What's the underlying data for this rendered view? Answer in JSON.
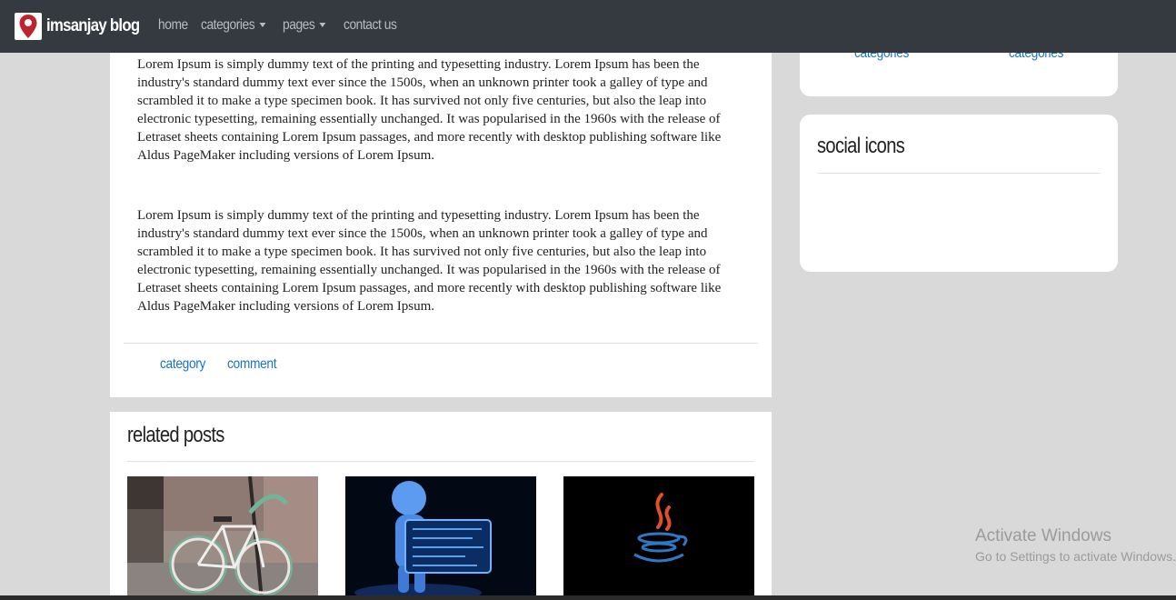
{
  "navbar": {
    "brand": "imsanjay blog",
    "items": [
      {
        "label": "home",
        "dropdown": false
      },
      {
        "label": "categories",
        "dropdown": true
      },
      {
        "label": "pages",
        "dropdown": true
      },
      {
        "label": "contact us",
        "dropdown": false
      }
    ]
  },
  "article": {
    "paragraphs": [
      "Lorem Ipsum is simply dummy text of the printing and typesetting industry. Lorem Ipsum has been the industry's standard dummy text ever since the 1500s, when an unknown printer took a galley of type and scrambled it to make a type specimen book. It has survived not only five centuries, but also the leap into electronic typesetting, remaining essentially unchanged. It was popularised in the 1960s with the release of Letraset sheets containing Lorem Ipsum passages, and more recently with desktop publishing software like Aldus PageMaker including versions of Lorem Ipsum.",
      "Lorem Ipsum is simply dummy text of the printing and typesetting industry. Lorem Ipsum has been the industry's standard dummy text ever since the 1500s, when an unknown printer took a galley of type and scrambled it to make a type specimen book. It has survived not only five centuries, but also the leap into electronic typesetting, remaining essentially unchanged. It was popularised in the 1960s with the release of Letraset sheets containing Lorem Ipsum passages, and more recently with desktop publishing software like Aldus PageMaker including versions of Lorem Ipsum."
    ],
    "footer_links": [
      "category",
      "comment"
    ]
  },
  "related": {
    "title": "related posts",
    "thumbnails": [
      "bicycle-photo",
      "hologram-figure-image",
      "java-logo-image"
    ]
  },
  "sidebar": {
    "category_links": [
      "categories",
      "categories"
    ],
    "social_title": "social icons"
  },
  "watermark": {
    "title": "Activate Windows",
    "subtitle": "Go to Settings to activate Windows."
  },
  "colors": {
    "navbar_bg": "#343a40",
    "link": "#1a73c8",
    "page_bg": "#d9d9d9"
  }
}
